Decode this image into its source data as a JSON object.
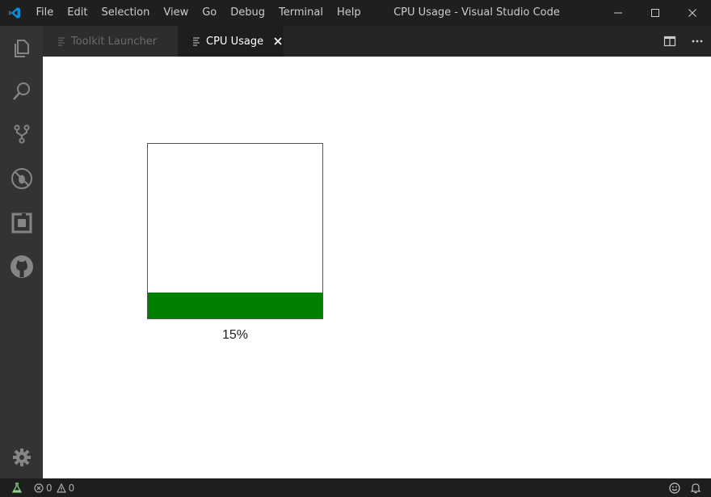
{
  "window": {
    "title": "CPU Usage - Visual Studio Code",
    "menu": [
      "File",
      "Edit",
      "Selection",
      "View",
      "Go",
      "Debug",
      "Terminal",
      "Help"
    ]
  },
  "activity_bar": {
    "items": [
      "files-icon",
      "search-icon",
      "source-control-icon",
      "debug-icon",
      "extensions-icon",
      "github-icon"
    ],
    "bottom": "gear-icon"
  },
  "tabs": [
    {
      "label": "Toolkit Launcher",
      "active": false
    },
    {
      "label": "CPU Usage",
      "active": true
    }
  ],
  "cpu": {
    "usage_label": "15%",
    "usage_fraction": 0.15,
    "fill_color": "#008000"
  },
  "status_bar": {
    "errors": "0",
    "warnings": "0"
  },
  "colors": {
    "accent": "#007acc",
    "titlebar": "#1f1f1f",
    "activitybar": "#333333",
    "editor_bg": "#ffffff"
  }
}
